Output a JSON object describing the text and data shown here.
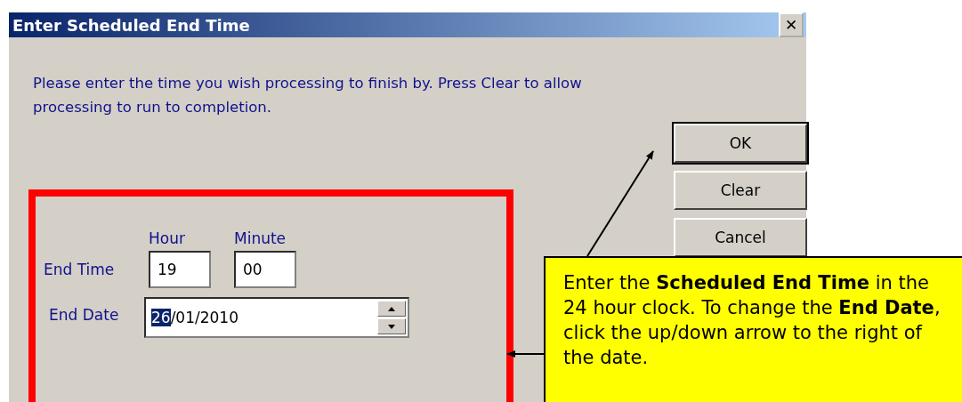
{
  "window": {
    "title": "Enter Scheduled End Time",
    "close": "✕"
  },
  "message": "Please enter the time you wish processing to finish by.  Press Clear to allow processing to run to completion.",
  "buttons": [
    {
      "label": "OK",
      "default": true
    },
    {
      "label": "Clear",
      "default": false
    },
    {
      "label": "Cancel",
      "default": false
    }
  ],
  "time": {
    "hour_heading": "Hour",
    "minute_heading": "Minute",
    "label": "End Time",
    "hour": "19",
    "minute": "00"
  },
  "date": {
    "label": "End Date",
    "segments": [
      {
        "text": "26",
        "selected": true
      },
      {
        "text": "/01/2010",
        "selected": false
      }
    ]
  },
  "callout": {
    "text": "Enter the **Scheduled End Time** in the 24 hour clock. To change the **End Date**, click the up/down arrow to the right of the date."
  }
}
